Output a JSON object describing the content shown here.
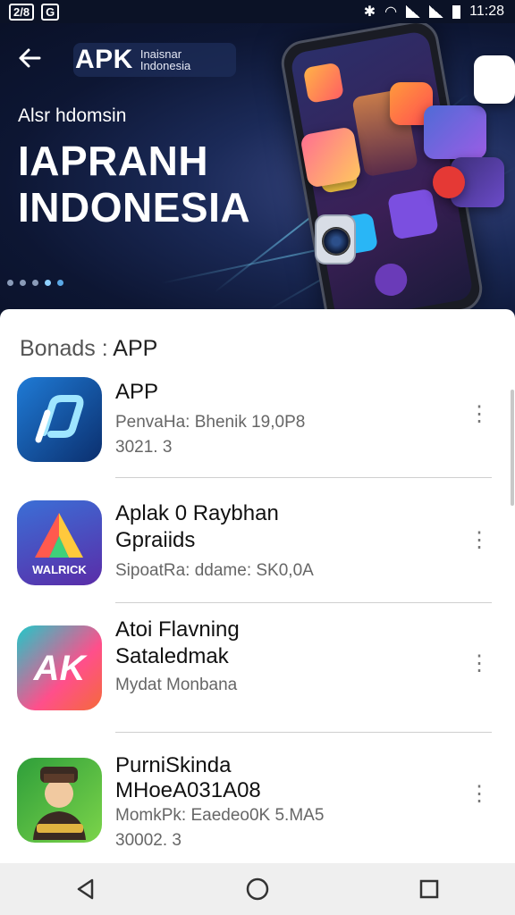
{
  "status_bar": {
    "left_items": [
      "2/8",
      "G"
    ],
    "time": "11:28",
    "icons": [
      "bluetooth-icon",
      "wifi-icon",
      "signal-icon",
      "battery-icon"
    ]
  },
  "header": {
    "back_icon": "arrow-left-icon",
    "logo_text": "APK",
    "logo_sub_line1": "Inaisnar",
    "logo_sub_line2": "Indonesia",
    "subtitle": "Alsr hdomsin",
    "title_line1": "IAPRANH",
    "title_line2": "INDONESIA",
    "carousel_dots": 5,
    "active_dot": 3
  },
  "section": {
    "label": "Bonads :",
    "label_app": "APP"
  },
  "apps": [
    {
      "name_line1": "APP",
      "name_line2": "",
      "meta_line1": "PenvaHa: Bhenik 19,0P8",
      "meta_line2": "3021. 3",
      "icon": "link-app-icon",
      "icon_label": ""
    },
    {
      "name_line1": "Aplak 0 Raybhan",
      "name_line2": "Gpraiids",
      "meta_line1": "SipoatRa: ddame: SK0,0A",
      "meta_line2": "",
      "icon": "walrick-app-icon",
      "icon_label": "WALRICK"
    },
    {
      "name_line1": "Atoi Flavning",
      "name_line2": "Sataledmak",
      "meta_line1": "Mydat Monbana",
      "meta_line2": "",
      "icon": "ak-app-icon",
      "icon_label": "AK"
    },
    {
      "name_line1": "PurniSkinda",
      "name_line2": "MHoeA031A08",
      "meta_line1": "MomkPk: Eaedeo0K 5.MA5",
      "meta_line2": "30002. 3",
      "icon": "character-app-icon",
      "icon_label": ""
    }
  ],
  "nav": {
    "back_icon": "triangle-back-icon",
    "home_icon": "circle-home-icon",
    "recents_icon": "square-recents-icon"
  },
  "colors": {
    "hero_dark": "#0d1633",
    "hero_mid": "#1b2a58",
    "accent_cyan": "#8fd0ff",
    "text_dark": "#111111",
    "text_meta": "#666666"
  }
}
